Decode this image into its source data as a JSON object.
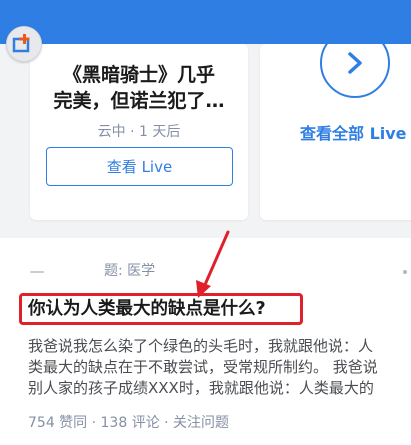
{
  "header": {
    "app_icon": "zhihu-add-icon",
    "accent_color": "#2f7ee3"
  },
  "live": {
    "card": {
      "title_line1": "《黑暗骑士》几乎",
      "title_line2": "完美，但诺兰犯了…",
      "meta": "云中 · 1 天后",
      "button_label": "查看 Live"
    },
    "view_all": {
      "icon": "chevron-right-icon",
      "label": "查看全部 Live"
    }
  },
  "feed": {
    "topic": "题: 医学",
    "question": "你认为人类最大的缺点是什么?",
    "excerpt_lines": [
      "我爸说我怎么染了个绿色的头毛时，我就跟他说：人",
      "类最大的缺点在于不敢尝试，受常规所制约。 我爸说",
      "别人家的孩子成绩XXX时，我就跟他说：人类最大的"
    ],
    "stats": "754 赞同 · 138 评论 · 关注问题",
    "highlight_color": "#e0202a"
  }
}
